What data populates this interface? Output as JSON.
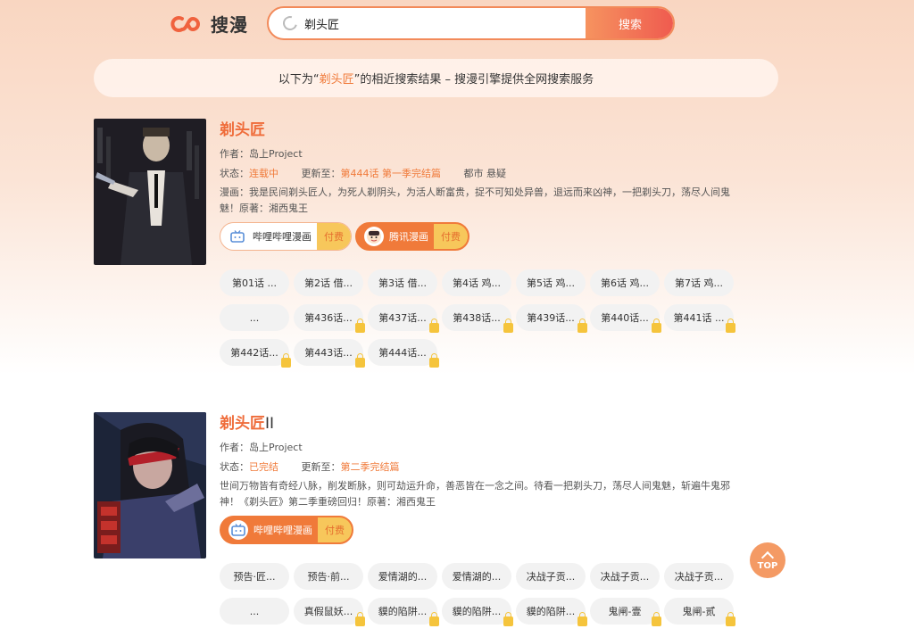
{
  "header": {
    "logo_text": "搜漫",
    "search_value": "剃头匠",
    "search_button": "搜索"
  },
  "notice": {
    "prefix": "以下为“",
    "keyword": "剃头匠",
    "suffix": "”的相近搜索结果 – 搜漫引擎提供全网搜索服务"
  },
  "results": [
    {
      "title": "剃头匠",
      "title_suffix": "",
      "author_label": "作者：",
      "author": "岛上Project",
      "status_label": "状态：",
      "status": "连载中",
      "update_label": "更新至：",
      "update": "第444话 第一季完结篇",
      "tags": "都市  悬疑",
      "desc": "漫画：我是民间剃头匠人，为死人剃阴头，为活人断富贵，捉不可知处异兽，退远而来凶神，一把剃头刀，荡尽人间鬼魅！原著：湘西鬼王",
      "sources": [
        {
          "name": "哔哩哔哩漫画",
          "tag": "付费",
          "icon": "bilibili-icon"
        },
        {
          "name": "腾讯漫画",
          "tag": "付费",
          "icon": "tencent-icon"
        }
      ],
      "chapters": [
        {
          "label": "第01话 ...",
          "locked": false
        },
        {
          "label": "第2话 借...",
          "locked": false
        },
        {
          "label": "第3话 借...",
          "locked": false
        },
        {
          "label": "第4话 鸡...",
          "locked": false
        },
        {
          "label": "第5话 鸡...",
          "locked": false
        },
        {
          "label": "第6话 鸡...",
          "locked": false
        },
        {
          "label": "第7话 鸡...",
          "locked": false
        },
        {
          "label": "...",
          "locked": false
        },
        {
          "label": "第436话...",
          "locked": true
        },
        {
          "label": "第437话...",
          "locked": true
        },
        {
          "label": "第438话...",
          "locked": true
        },
        {
          "label": "第439话...",
          "locked": true
        },
        {
          "label": "第440话...",
          "locked": true
        },
        {
          "label": "第441话 ...",
          "locked": true
        },
        {
          "label": "第442话...",
          "locked": true
        },
        {
          "label": "第443话...",
          "locked": true
        },
        {
          "label": "第444话...",
          "locked": true
        }
      ]
    },
    {
      "title": "剃头匠",
      "title_suffix": "II",
      "author_label": "作者：",
      "author": "岛上Project",
      "status_label": "状态：",
      "status": "已完结",
      "update_label": "更新至：",
      "update": "第二季完结篇",
      "tags": "",
      "desc": "世间万物皆有奇经八脉，削发断脉，则可劫运升命，善恶皆在一念之间。待看一把剃头刀，荡尽人间鬼魅，斩遍牛鬼邪神！《剃头匠》第二季重磅回归！原著：湘西鬼王",
      "sources": [
        {
          "name": "哔哩哔哩漫画",
          "tag": "付费",
          "icon": "bilibili-icon"
        }
      ],
      "chapters": [
        {
          "label": "预告·匠...",
          "locked": false
        },
        {
          "label": "预告·前...",
          "locked": false
        },
        {
          "label": "爱情湖的...",
          "locked": false
        },
        {
          "label": "爱情湖的...",
          "locked": false
        },
        {
          "label": "决战子贡...",
          "locked": false
        },
        {
          "label": "决战子贡...",
          "locked": false
        },
        {
          "label": "决战子贡...",
          "locked": false
        },
        {
          "label": "...",
          "locked": false
        },
        {
          "label": "真假鼠妖...",
          "locked": true
        },
        {
          "label": "貘的陷阱...",
          "locked": true
        },
        {
          "label": "貘的陷阱...",
          "locked": true
        },
        {
          "label": "貘的陷阱...",
          "locked": true
        },
        {
          "label": "鬼闸-壹",
          "locked": true
        },
        {
          "label": "鬼闸-贰",
          "locked": true
        }
      ]
    }
  ],
  "top_button": "TOP",
  "colors": {
    "accent": "#f07a3a",
    "tag_bg": "#f7c75b"
  }
}
